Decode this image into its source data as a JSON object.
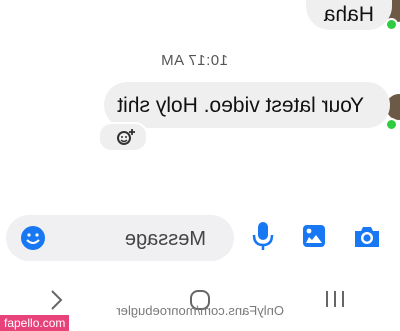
{
  "messages": {
    "top_text": "Haha",
    "timestamp": "10:17 AM",
    "main_text": "Your latest video. Holy shit"
  },
  "composer": {
    "placeholder": "Message"
  },
  "watermark": "OnlyFans.com/monroebugler",
  "site_tag": "fapello.com",
  "colors": {
    "accent": "#1877f2",
    "bubble": "#efeff0",
    "online": "#2ecc40",
    "site_tag": "#e8427a"
  },
  "icons": [
    "camera-icon",
    "image-icon",
    "mic-icon",
    "emoji-icon",
    "add-reaction-icon",
    "back-nav-icon",
    "home-nav-icon",
    "recents-nav-icon"
  ]
}
